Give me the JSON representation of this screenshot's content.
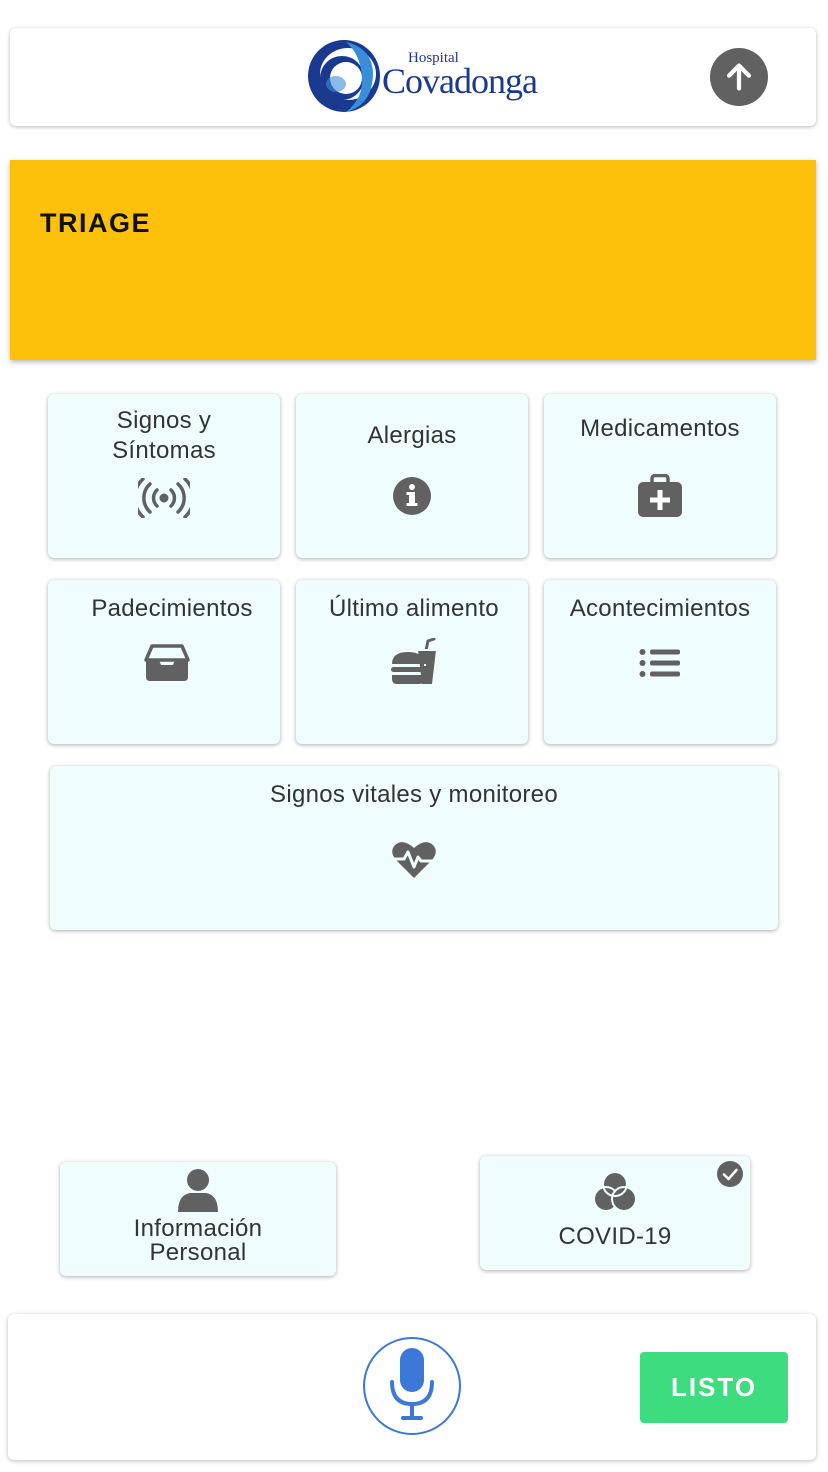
{
  "header": {
    "logo_text_small": "Hospital",
    "logo_text_large": "Covadonga",
    "up_icon": "arrow-up-icon"
  },
  "banner": {
    "title": "TRIAGE"
  },
  "tiles": [
    {
      "label": "Signos y Síntomas",
      "icon": "broadcast-icon"
    },
    {
      "label": "Alergias",
      "icon": "info-circle-icon"
    },
    {
      "label": "Medicamentos",
      "icon": "medkit-icon"
    },
    {
      "label": "Padecimientos",
      "icon": "archive-tray-icon"
    },
    {
      "label": "Último alimento",
      "icon": "food-icon"
    },
    {
      "label": "Acontecimientos",
      "icon": "list-icon"
    },
    {
      "label": "Signos vitales y monitoreo",
      "icon": "heartbeat-icon"
    }
  ],
  "bottom_tiles": [
    {
      "label_line1": "Información",
      "label_line2": "Personal",
      "icon": "user-icon"
    },
    {
      "label": "COVID-19",
      "icon": "venn-icon",
      "check_icon": "check-circle-icon"
    }
  ],
  "footer": {
    "mic_icon": "microphone-icon",
    "done_label": "LISTO"
  },
  "colors": {
    "banner": "#fdc10b",
    "tile_bg": "#f0fdfe",
    "done_button": "#3ddc7e",
    "mic_accent": "#3b78d8",
    "icon_gray": "#616161",
    "logo_blue": "#1a3a8f"
  }
}
